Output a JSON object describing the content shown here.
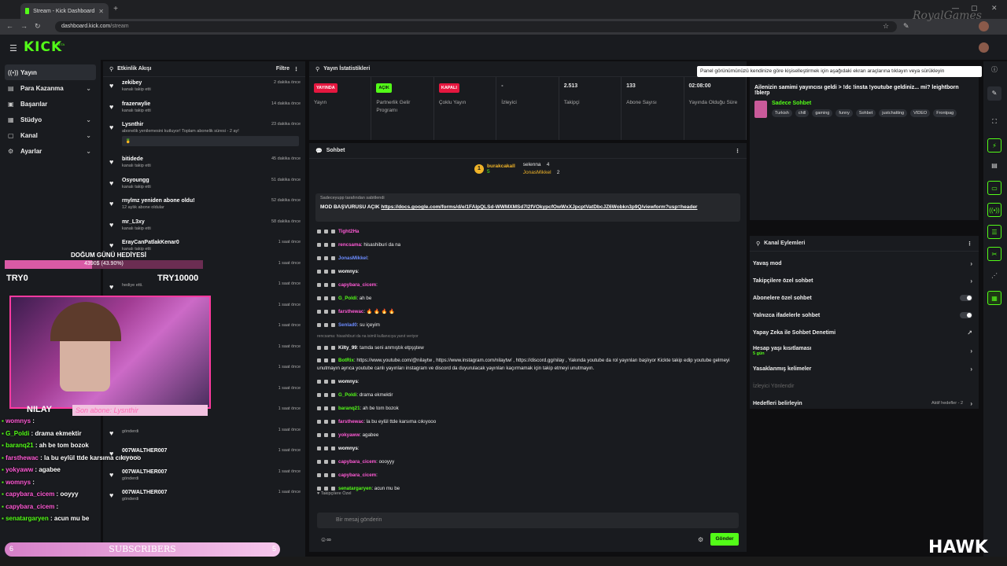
{
  "browser": {
    "tab_title": "Stream - Kick Dashboard",
    "url_host": "dashboard.kick.com",
    "url_path": "/stream"
  },
  "logo": "KICK",
  "beta": "BETA",
  "nav": [
    {
      "label": "Yayın",
      "icon": "broadcast-icon",
      "active": true
    },
    {
      "label": "Para Kazanma",
      "icon": "money-icon",
      "chevron": true
    },
    {
      "label": "Başarılar",
      "icon": "achievements-icon"
    },
    {
      "label": "Stüdyo",
      "icon": "studio-icon",
      "chevron": true
    },
    {
      "label": "Kanal",
      "icon": "channel-icon",
      "chevron": true
    },
    {
      "label": "Ayarlar",
      "icon": "settings-icon",
      "chevron": true
    }
  ],
  "activity": {
    "title": "Etkinlik Akışı",
    "filter": "Filtre",
    "items": [
      {
        "name": "zekibey",
        "sub": "kanalı takip etti",
        "time": "2 dakika önce"
      },
      {
        "name": "frazerwylie",
        "sub": "kanalı takip etti",
        "time": "14 dakika önce"
      },
      {
        "name": "Lysnthir",
        "sub": "abonelik yenilemesini kutluyor! Toplam abonelik süresi - 2 ay!",
        "time": "23 dakika önce",
        "box": "🍍"
      },
      {
        "name": "bitidede",
        "sub": "kanalı takip etti",
        "time": "45 dakika önce"
      },
      {
        "name": "Osyoungg",
        "sub": "kanalı takip etti",
        "time": "51 dakika önce"
      },
      {
        "name": "rnylmz yeniden abone oldu!",
        "sub": "12 aylık abone oldular",
        "time": "52 dakika önce"
      },
      {
        "name": "mr_L3xy",
        "sub": "kanalı takip etti",
        "time": "58 dakika önce"
      },
      {
        "name": "ErayCanPatlakKenar0",
        "sub": "kanalı takip etti",
        "time": "1 saat önce"
      },
      {
        "name": "",
        "sub": "hediye etti.",
        "time": "1 saat önce"
      },
      {
        "name": "",
        "sub": "hediye etti.",
        "time": "1 saat önce"
      },
      {
        "name": "",
        "sub": "",
        "time": "1 saat önce"
      },
      {
        "name": "",
        "sub": "",
        "time": "1 saat önce"
      },
      {
        "name": "",
        "sub": "",
        "time": "1 saat önce"
      },
      {
        "name": "",
        "sub": "hediye etti.",
        "time": "1 saat önce"
      },
      {
        "name": "",
        "sub": "",
        "time": "1 saat önce"
      },
      {
        "name": "",
        "sub": "",
        "time": "1 saat önce"
      },
      {
        "name": "",
        "sub": "gönderdi",
        "time": "1 saat önce"
      },
      {
        "name": "007WALTHER007",
        "sub": "gönderdi",
        "time": "1 saat önce"
      },
      {
        "name": "007WALTHER007",
        "sub": "gönderdi",
        "time": "1 saat önce"
      },
      {
        "name": "007WALTHER007",
        "sub": "gönderdi",
        "time": "1 saat önce"
      }
    ]
  },
  "stats": {
    "title": "Yayın İstatistikleri",
    "cells": [
      {
        "badge": "YAYINDA",
        "badge_color": "#e5173f",
        "label": "Yayın"
      },
      {
        "badge": "AÇIK",
        "badge_color": "#53fc18",
        "label": "Partnerlik Gelir Programı"
      },
      {
        "badge": "KAPALI",
        "badge_color": "#e5173f",
        "label": "Çoklu Yayın"
      },
      {
        "value": "-",
        "label": "İzleyici"
      },
      {
        "value": "2.513",
        "label": "Takipçi"
      },
      {
        "value": "133",
        "label": "Abone Sayısı"
      },
      {
        "value": "02:08:00",
        "label": "Yayında Olduğu Süre"
      }
    ]
  },
  "chat": {
    "title": "Sohbet",
    "leaders": [
      {
        "name": "burakcakall",
        "count": "5"
      },
      {
        "name": "selenna",
        "count": "4"
      },
      {
        "name": "JonasMikkel",
        "count": "2"
      }
    ],
    "pinned_by": "Sadeceyupp tarafından sabitlendi",
    "pinned_msg": "MOD BAŞVURUSU AÇIK",
    "pinned_link": "https://docs.google.com/forms/d/e/1FAIpQLSd-WWMXMSd7I2fVOkypcfOwWxXJpcptVatDbcJZ6Wobkn3p9Q/viewform?usp=header",
    "messages": [
      {
        "user": "Tight2Ha",
        "color": "#ff5ad5",
        "text": ""
      },
      {
        "user": "rencsama",
        "color": "#ff5ad5",
        "text": ": hisashiburi da na"
      },
      {
        "user": "JonasMikkel",
        "color": "#6c8cff",
        "text": ":"
      },
      {
        "user": "womnys",
        "color": "#fff",
        "text": ":"
      },
      {
        "user": "capybara_cicem",
        "color": "#ff5ad5",
        "text": ":"
      },
      {
        "user": "G_Poldi",
        "color": "#53fc18",
        "text": ": ah be"
      },
      {
        "user": "farsthewac",
        "color": "#ff5ad5",
        "text": ": 🔥 🔥 🔥 🔥"
      },
      {
        "user": "Senlad0",
        "color": "#6c8cff",
        "text": ": su içeyim"
      },
      {
        "reply": "rencsama: hisashiburi da na isimli kullanıcıya yanıt veriyor"
      },
      {
        "user": "Kilty_99",
        "color": "#fff",
        "text": ": tamda seni anmıştık etpşştew"
      },
      {
        "user": "BotRix",
        "color": "#53fc18",
        "long": true,
        "text": ": https://www.youtube.com/@nilaytw , https://www.instagram.com/nilaytw/ , https://discord.gg/nilay , Yakında youtube da rol yayınları başlıyor Kickte takip edip youtube gelmeyi unutmayın ayrıca youtube canlı yayınları instagram ve discord da duyurulacak yayınları kaçırmamak için takip etmeyi unutmayın."
      },
      {
        "user": "womnys",
        "color": "#fff",
        "text": ":"
      },
      {
        "user": "G_Poldi",
        "color": "#53fc18",
        "text": ": drama ekmektir"
      },
      {
        "user": "baranq21",
        "color": "#53fc18",
        "text": ": ah be tom bozok"
      },
      {
        "user": "farsthewac",
        "color": "#ff5ad5",
        "text": ": la bu eylül ttde karsıma cıkıyooo"
      },
      {
        "user": "yokyaww",
        "color": "#ff5ad5",
        "text": ": agabee"
      },
      {
        "user": "womnys",
        "color": "#fff",
        "text": ":"
      },
      {
        "user": "capybara_cicem",
        "color": "#ff5ad5",
        "text": ": oooyyy"
      },
      {
        "user": "capybara_cicem",
        "color": "#ff5ad5",
        "text": ":"
      },
      {
        "user": "senatargaryen",
        "color": "#53fc18",
        "text": ": acun mu be"
      }
    ],
    "followers_only": "Takipçilere Özel",
    "input_placeholder": "Bir mesaj gönderin",
    "send": "Gönder"
  },
  "info": {
    "tooltip": "Panel görünümünüzü kendinize göre kişiselleştirmek için aşağıdaki ekran araçlarına tıklayın veya sürükleyin",
    "stream_title": "Ailenizin samimi yayıncısı geldi > !dc !insta !youtube geldiniz... mi? leightborn !blerp",
    "category": "Sadece Sohbet",
    "tags": [
      "Turkish",
      "chill",
      "gaming",
      "funny",
      "Sohbet",
      "justchatting",
      "VIDEO",
      "Frontpag"
    ]
  },
  "channel_actions": {
    "title": "Kanal Eylemleri",
    "items": [
      {
        "label": "Yavaş mod",
        "kind": "chevron"
      },
      {
        "label": "Takipçilere özel sohbet",
        "kind": "chevron"
      },
      {
        "label": "Abonelere özel sohbet",
        "kind": "toggle"
      },
      {
        "label": "Yalnızca ifadelerle sohbet",
        "kind": "toggle"
      },
      {
        "label": "Yapay Zeka ile Sohbet Denetimi",
        "kind": "external"
      },
      {
        "label": "Hesap yaşı kısıtlaması",
        "sub": "5 gün",
        "kind": "chevron"
      },
      {
        "label": "Yasaklanmış kelimeler",
        "kind": "chevron"
      },
      {
        "label": "İzleyici Yönlendir",
        "kind": "disabled"
      },
      {
        "label": "Hedefleri belirleyin",
        "extra": "Aktif hedefler - 2",
        "kind": "chevron"
      }
    ]
  },
  "overlay": {
    "bday_title": "DOĞUM GÜNÜ HEDİYESİ",
    "bday_progress": "4390$ (43.90%)",
    "bday_fraction": 0.439,
    "bday_min": "TRY0",
    "bday_max": "TRY10000",
    "streamer": "NILAY",
    "last_sub": "Son abone: Lysnthir",
    "chat": [
      {
        "user": "womnys",
        "color": "#ff5ad5",
        "text": " : "
      },
      {
        "user": "G_Poldi",
        "color": "#53fc18",
        "text": " : drama ekmektir"
      },
      {
        "user": "baranq21",
        "color": "#53fc18",
        "text": " : ah be tom bozok"
      },
      {
        "user": "farsthewac",
        "color": "#ff5ad5",
        "text": " : la bu eylül ttde karsıma cıkıyooo"
      },
      {
        "user": "yokyaww",
        "color": "#ff5ad5",
        "text": " : agabee"
      },
      {
        "user": "womnys",
        "color": "#ff5ad5",
        "text": " : "
      },
      {
        "user": "capybara_cicem",
        "color": "#ff5ad5",
        "text": " : ooyyy"
      },
      {
        "user": "capybara_cicem",
        "color": "#ff5ad5",
        "text": " : "
      },
      {
        "user": "senatargaryen",
        "color": "#53fc18",
        "text": " : acun mu be"
      }
    ],
    "subs_label": "SUBSCRIBERS",
    "subs_left": "6",
    "subs_right": "5",
    "hawk": "HAWK"
  },
  "watermark": "RoyalGames"
}
